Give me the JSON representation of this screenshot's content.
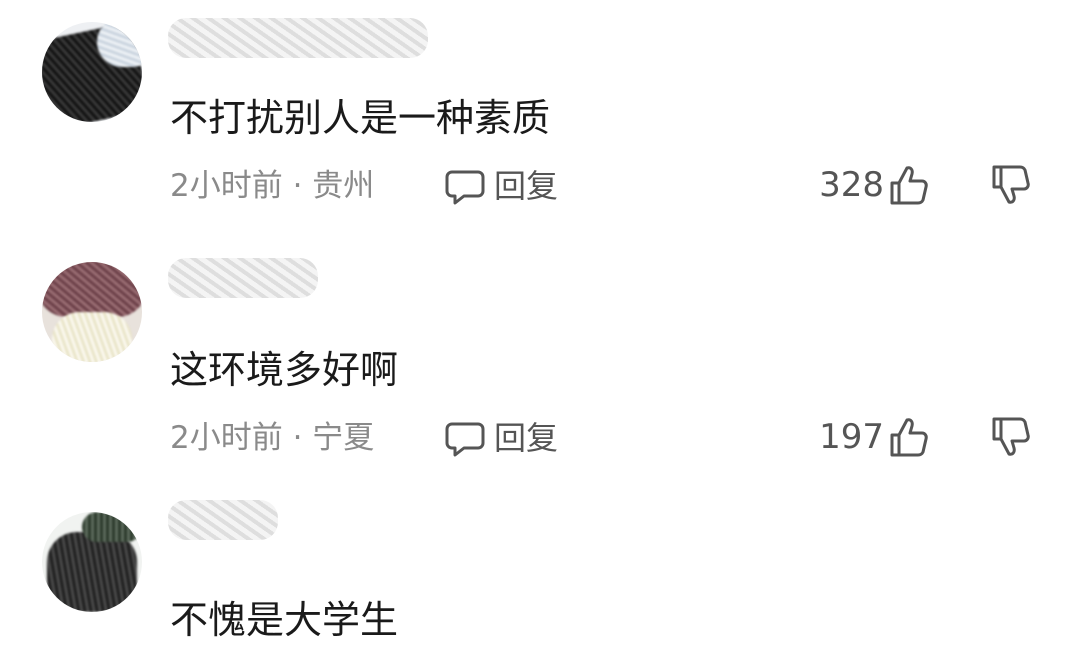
{
  "comments": [
    {
      "text": "不打扰别人是一种素质",
      "meta": "2小时前 · 贵州",
      "reply_label": "回复",
      "likes": "328"
    },
    {
      "text": "这环境多好啊",
      "meta": "2小时前 · 宁夏",
      "reply_label": "回复",
      "likes": "197"
    },
    {
      "text": "不愧是大学生"
    }
  ],
  "icons": {
    "reply": "speech-bubble-icon",
    "like": "thumbs-up-icon",
    "dislike": "thumbs-down-icon"
  },
  "colors": {
    "meta_text": "#8a8a8a",
    "icon_stroke": "#555555"
  }
}
